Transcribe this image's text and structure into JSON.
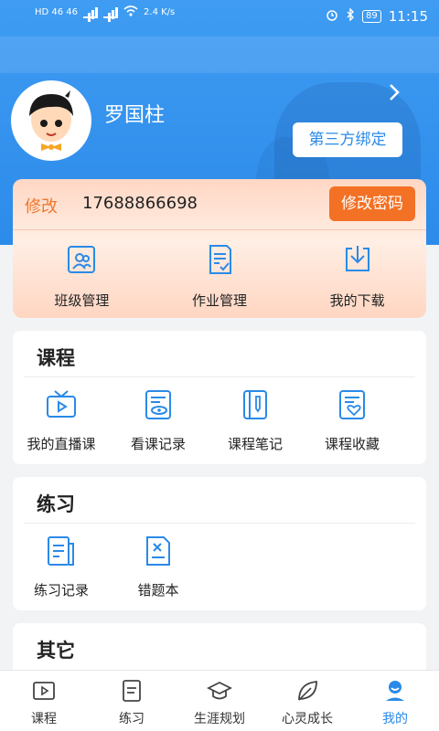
{
  "status_bar": {
    "left_text": "HD 46 46",
    "speed": "2.4 K/s",
    "battery": "89",
    "time": "11:15"
  },
  "profile": {
    "name": "罗国柱",
    "bind_button": "第三方绑定",
    "edit_label": "修改",
    "phone": "17688866698",
    "change_password": "修改密码",
    "quick_items": [
      {
        "label": "班级管理",
        "icon": "class-manage-icon"
      },
      {
        "label": "作业管理",
        "icon": "homework-manage-icon"
      },
      {
        "label": "我的下载",
        "icon": "download-icon"
      }
    ]
  },
  "courses": {
    "title": "课程",
    "items": [
      {
        "label": "我的直播课",
        "icon": "live-tv-icon"
      },
      {
        "label": "看课记录",
        "icon": "watch-record-icon"
      },
      {
        "label": "课程笔记",
        "icon": "notebook-icon"
      },
      {
        "label": "课程收藏",
        "icon": "favorite-icon"
      }
    ]
  },
  "practice": {
    "title": "练习",
    "items": [
      {
        "label": "练习记录",
        "icon": "practice-record-icon"
      },
      {
        "label": "错题本",
        "icon": "wrong-answers-icon"
      }
    ]
  },
  "other": {
    "title": "其它"
  },
  "nav": {
    "items": [
      {
        "label": "课程",
        "icon": "play-icon"
      },
      {
        "label": "练习",
        "icon": "document-icon"
      },
      {
        "label": "生涯规划",
        "icon": "graduation-cap-icon"
      },
      {
        "label": "心灵成长",
        "icon": "leaf-icon"
      },
      {
        "label": "我的",
        "icon": "user-icon",
        "active": true
      }
    ]
  },
  "colors": {
    "primary_blue": "#2a8ae8",
    "accent_orange": "#f37125"
  }
}
